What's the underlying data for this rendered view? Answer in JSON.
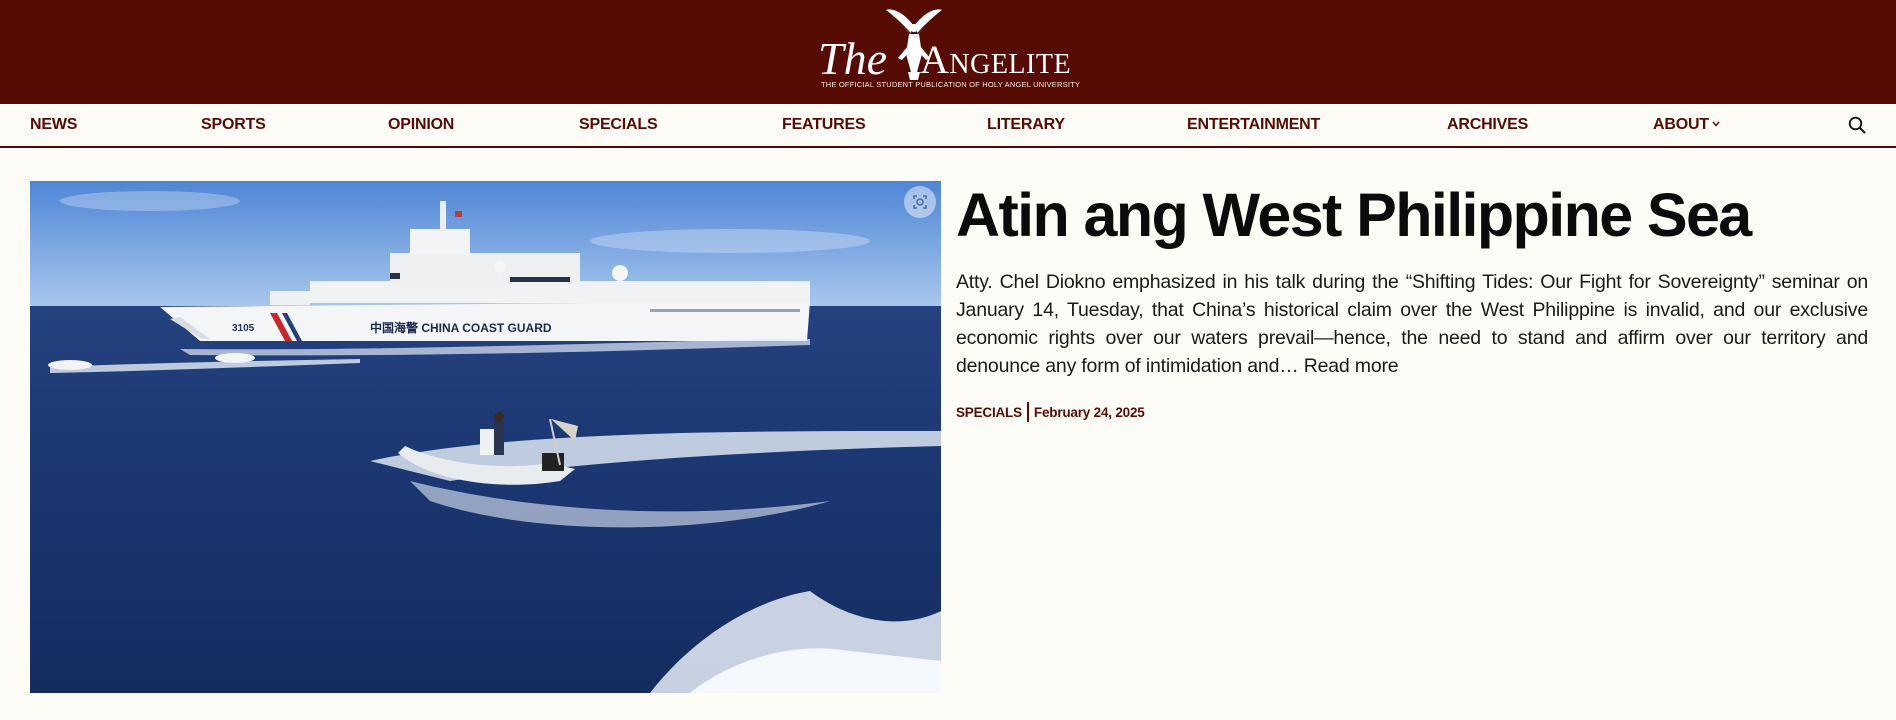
{
  "masthead": {
    "logo_the": "The",
    "logo_name": "Angelite",
    "tagline": "THE OFFICIAL STUDENT PUBLICATION OF HOLY ANGEL UNIVERSITY"
  },
  "nav": {
    "items": [
      {
        "label": "NEWS"
      },
      {
        "label": "SPORTS"
      },
      {
        "label": "OPINION"
      },
      {
        "label": "SPECIALS"
      },
      {
        "label": "FEATURES"
      },
      {
        "label": "LITERARY"
      },
      {
        "label": "ENTERTAINMENT"
      },
      {
        "label": "ARCHIVES"
      },
      {
        "label": "ABOUT"
      }
    ],
    "search_icon": "search-icon"
  },
  "hero": {
    "image_alt": "China Coast Guard ship and a rubber boat at sea",
    "ship_hull_number": "3105",
    "ship_hull_text": "中国海警  CHINA COAST GUARD",
    "title": "Atin ang West Philippine Sea",
    "excerpt": "Atty. Chel Diokno emphasized in his talk during the “Shifting Tides: Our Fight for Sovereignty” seminar on January 14, Tuesday, that China’s historical claim over the West Philippine is invalid, and our exclusive economic rights over our waters prevail—hence, the need to stand and affirm over our territory and denounce any form of intimidation and…",
    "read_more": "Read more",
    "category": "SPECIALS",
    "date": "February 24, 2025"
  },
  "colors": {
    "brand": "#560c04",
    "background": "#fdfcf7",
    "text": "#111111"
  }
}
